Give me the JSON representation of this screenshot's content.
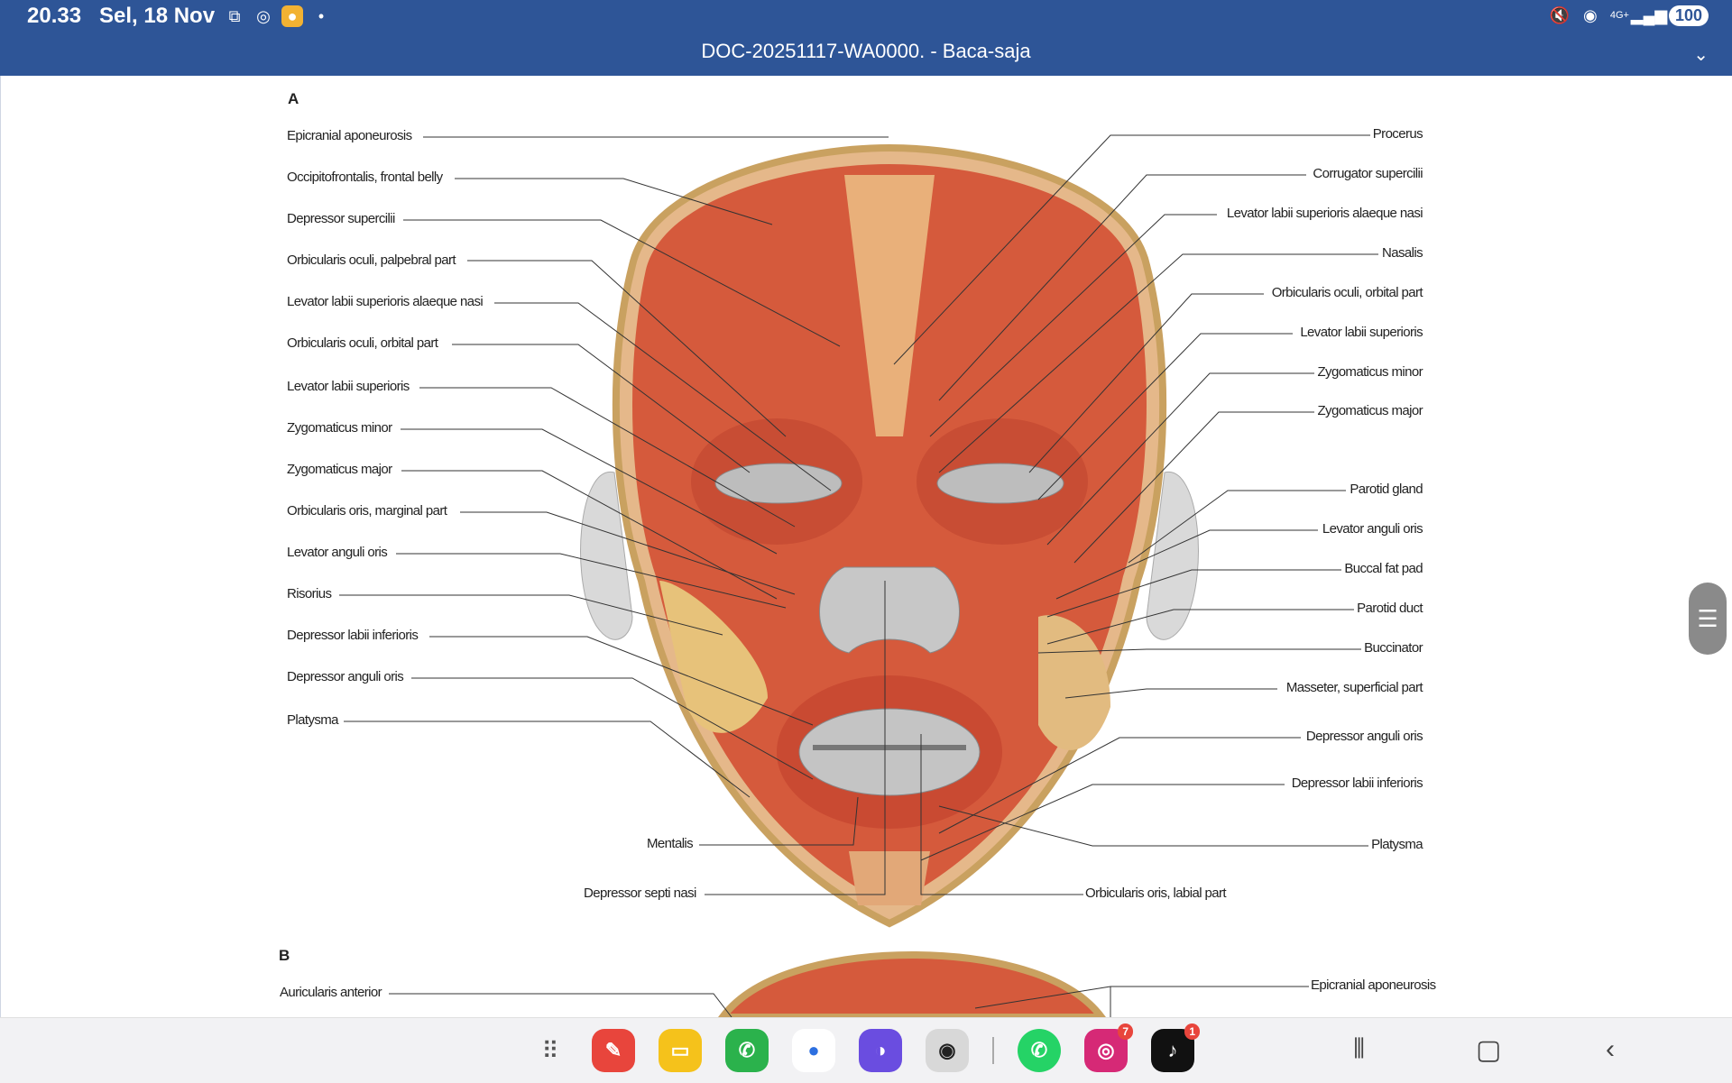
{
  "status_bar": {
    "time": "20.33",
    "date": "Sel, 18 Nov",
    "battery": "100",
    "network": "4G+"
  },
  "document": {
    "title": "DOC-20251117-WA0000. - Baca-saja"
  },
  "figure": {
    "panel_a": "A",
    "panel_b": "B",
    "left_labels": [
      "Epicranial aponeurosis",
      "Occipitofrontalis, frontal belly",
      "Depressor supercilii",
      "Orbicularis oculi, palpebral part",
      "Levator labii superioris alaeque nasi",
      "Orbicularis oculi, orbital part",
      "Levator labii superioris",
      "Zygomaticus minor",
      "Zygomaticus major",
      "Orbicularis oris, marginal part",
      "Levator anguli oris",
      "Risorius",
      "Depressor labii inferioris",
      "Depressor anguli oris",
      "Platysma"
    ],
    "right_labels": [
      "Procerus",
      "Corrugator supercilii",
      "Levator labii superioris alaeque nasi",
      "Nasalis",
      "Orbicularis oculi, orbital part",
      "Levator labii superioris",
      "Zygomaticus minor",
      "Zygomaticus major",
      "Parotid gland",
      "Levator anguli oris",
      "Buccal fat pad",
      "Parotid duct",
      "Buccinator",
      "Masseter, superficial part",
      "Depressor anguli oris",
      "Depressor labii inferioris",
      "Platysma"
    ],
    "bottom_labels": {
      "mentalis": "Mentalis",
      "depressor_septi": "Depressor septi nasi",
      "orbicularis_labial": "Orbicularis oris, labial part"
    },
    "panel_b_labels": {
      "left": "Auricularis anterior",
      "right": "Epicranial aponeurosis"
    }
  },
  "dock": {
    "apps": [
      {
        "name": "notes",
        "badge": ""
      },
      {
        "name": "files",
        "badge": ""
      },
      {
        "name": "phone",
        "badge": ""
      },
      {
        "name": "messages",
        "badge": ""
      },
      {
        "name": "browser",
        "badge": ""
      },
      {
        "name": "camera",
        "badge": ""
      },
      {
        "name": "whatsapp",
        "badge": ""
      },
      {
        "name": "instagram",
        "badge": "7"
      },
      {
        "name": "tiktok",
        "badge": "1"
      }
    ]
  }
}
